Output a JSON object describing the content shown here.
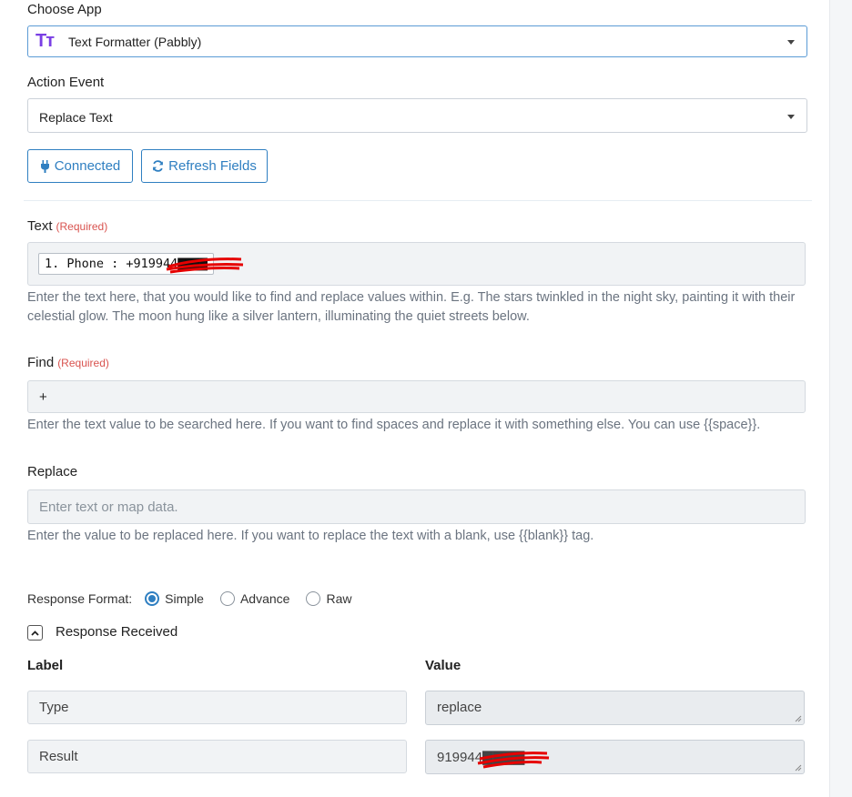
{
  "choose_app": {
    "label": "Choose App",
    "app_name": "Text Formatter (Pabbly)",
    "app_icon_text": "Tт",
    "icon_color": "#7a3fe4"
  },
  "action_event": {
    "label": "Action Event",
    "value": "Replace Text"
  },
  "buttons": {
    "connected": "Connected",
    "refresh": "Refresh Fields",
    "color": "#2f7fc1"
  },
  "fields": {
    "text": {
      "label": "Text",
      "required": "(Required)",
      "chip": "1. Phone : +919944▇▇▇▇",
      "help": "Enter the text here, that you would like to find and replace values within. E.g. The stars twinkled in the night sky, painting it with their celestial glow. The moon hung like a silver lantern, illuminating the quiet streets below."
    },
    "find": {
      "label": "Find",
      "required": "(Required)",
      "value": "+",
      "help": "Enter the text value to be searched here. If you want to find spaces and replace it with something else. You can use {{space}}."
    },
    "replace": {
      "label": "Replace",
      "placeholder": "Enter text or map data.",
      "help": "Enter the value to be replaced here. If you want to replace the text with a blank, use {{blank}} tag."
    }
  },
  "response": {
    "format_label": "Response Format:",
    "options": [
      "Simple",
      "Advance",
      "Raw"
    ],
    "selected": "Simple",
    "received_label": "Response Received",
    "col_label": "Label",
    "col_value": "Value",
    "rows": [
      {
        "label": "Type",
        "value": "replace"
      },
      {
        "label": "Result",
        "value": "919944▇▇▇▇"
      }
    ]
  },
  "colors": {
    "accent": "#2f7fc1",
    "required": "#d9534f",
    "redaction": "#e60000"
  }
}
